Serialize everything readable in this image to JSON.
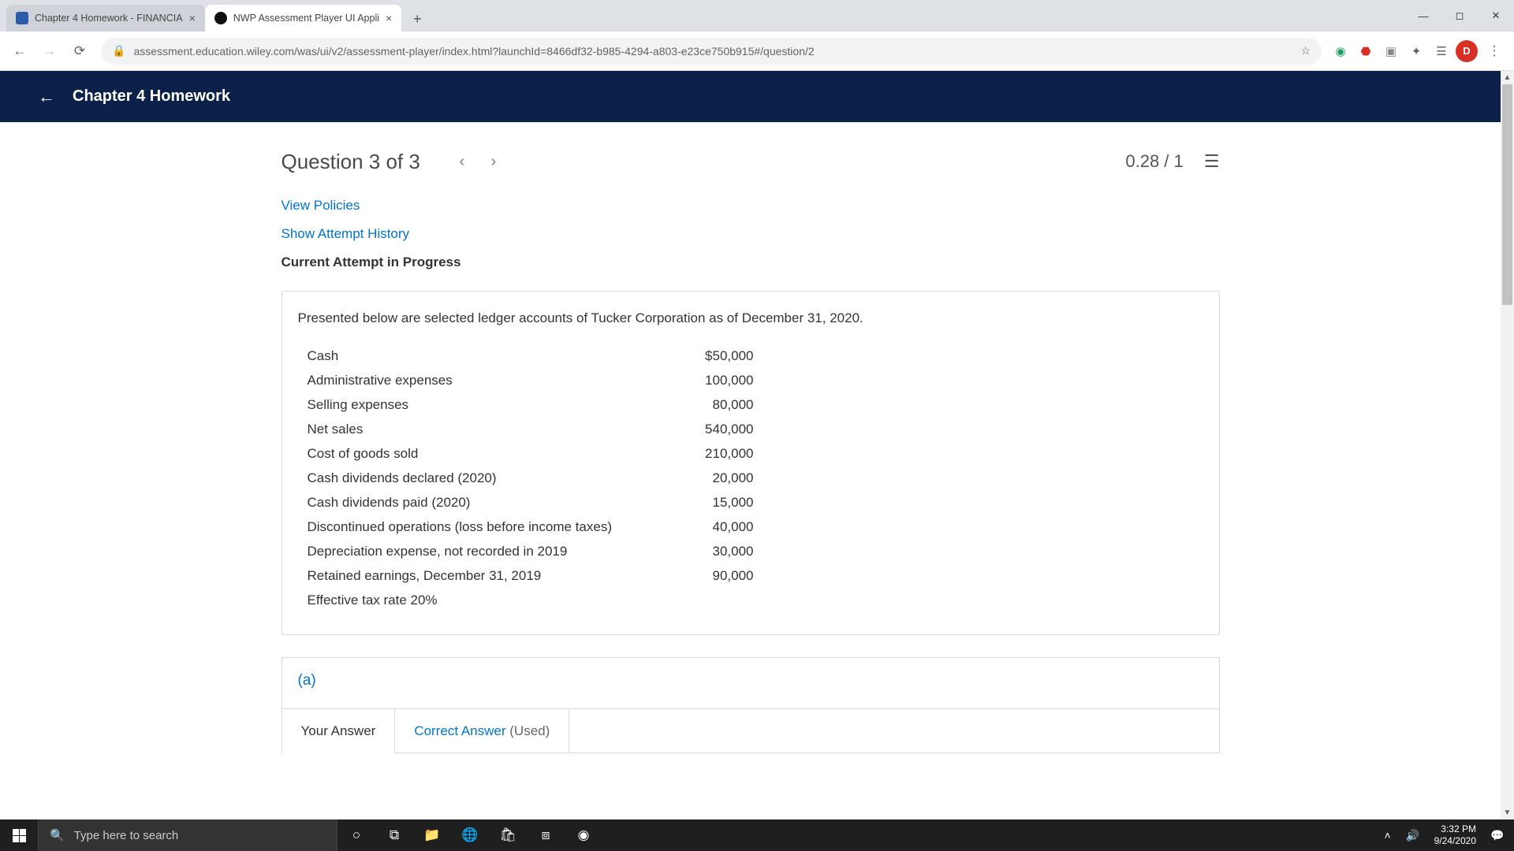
{
  "browser": {
    "tabs": [
      {
        "label": "Chapter 4 Homework - FINANCIA"
      },
      {
        "label": "NWP Assessment Player UI Appli"
      }
    ],
    "url": "assessment.education.wiley.com/was/ui/v2/assessment-player/index.html?launchId=8466df32-b985-4294-a803-e23ce750b915#/question/2",
    "avatar_letter": "D"
  },
  "app": {
    "header_title": "Chapter 4 Homework",
    "question_title": "Question 3 of 3",
    "score": "0.28 / 1",
    "links": {
      "policies": "View Policies",
      "history": "Show Attempt History",
      "status": "Current Attempt in Progress"
    },
    "intro": "Presented below are selected ledger accounts of Tucker Corporation as of December 31, 2020.",
    "ledger": [
      {
        "label": "Cash",
        "value": "$50,000"
      },
      {
        "label": "Administrative expenses",
        "value": "100,000"
      },
      {
        "label": "Selling expenses",
        "value": "80,000"
      },
      {
        "label": "Net sales",
        "value": "540,000"
      },
      {
        "label": "Cost of goods sold",
        "value": "210,000"
      },
      {
        "label": "Cash dividends declared (2020)",
        "value": "20,000"
      },
      {
        "label": "Cash dividends paid (2020)",
        "value": "15,000"
      },
      {
        "label": "Discontinued operations (loss before income taxes)",
        "value": "40,000"
      },
      {
        "label": "Depreciation expense, not recorded in 2019",
        "value": "30,000"
      },
      {
        "label": "Retained earnings, December 31, 2019",
        "value": "90,000"
      },
      {
        "label": "Effective tax rate 20%",
        "value": ""
      }
    ],
    "part_label": "(a)",
    "answer_tabs": {
      "your": "Your Answer",
      "correct_prefix": "Correct Answer",
      "correct_suffix": " (Used)"
    }
  },
  "taskbar": {
    "search_placeholder": "Type here to search",
    "time": "3:32 PM",
    "date": "9/24/2020"
  }
}
